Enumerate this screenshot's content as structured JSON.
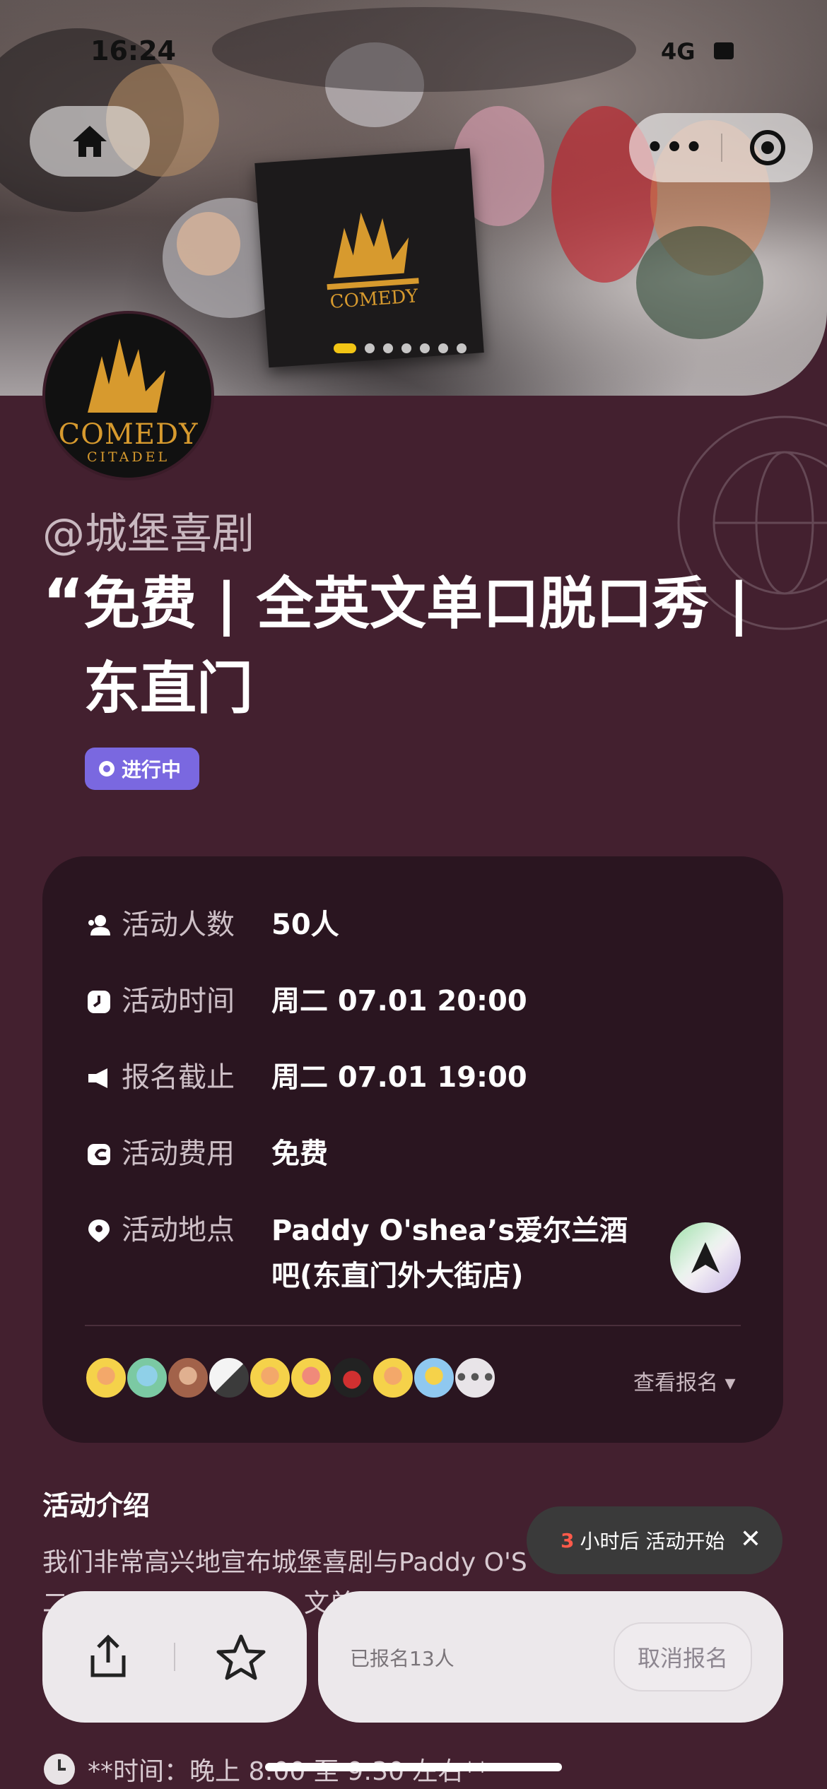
{
  "status_bar": {
    "time": "16:24",
    "network": "4G"
  },
  "top_bar": {
    "more_label": "•••"
  },
  "organizer": "@城堡喜剧",
  "title_quote": "“",
  "title": "免费 | 全英文单口脱口秀 | 东直门",
  "status_badge": "进行中",
  "logo": {
    "line1": "COMEDY",
    "line2": "CITADEL"
  },
  "hero": {
    "slide_count": 7,
    "active_slide": 1
  },
  "info": {
    "rows": [
      {
        "label": "活动人数",
        "value": "50人",
        "icon": "people-icon"
      },
      {
        "label": "活动时间",
        "value": "周二 07.01 20:00",
        "icon": "clock-icon"
      },
      {
        "label": "报名截止",
        "value": "周二 07.01 19:00",
        "icon": "megaphone-icon"
      },
      {
        "label": "活动费用",
        "value": "免费",
        "icon": "wallet-icon"
      },
      {
        "label": "活动地点",
        "value": "Paddy O'shea’s爱尔兰酒吧(东直门外大街店)",
        "icon": "location-pin-icon"
      }
    ],
    "view_registrations": "查看报名 ▾",
    "more_avatars": "•••"
  },
  "intro": {
    "title": "活动介绍",
    "text_line1": "我们非常高兴地宣布城堡喜剧与Paddy O'S",
    "text_line2": "二",
    "text_line3": "文单",
    "time_line": "**时间：晚上 8:00 至 9:30 左右**"
  },
  "toast": {
    "number": "3",
    "text": "小时后 活动开始",
    "close": "✕"
  },
  "bottom_bar": {
    "registered": "已报名13人",
    "cancel": "取消报名"
  },
  "colors": {
    "background": "#43202f",
    "card": "#2a1520",
    "badge": "#7a68e0",
    "active_dot": "#f2c515"
  }
}
